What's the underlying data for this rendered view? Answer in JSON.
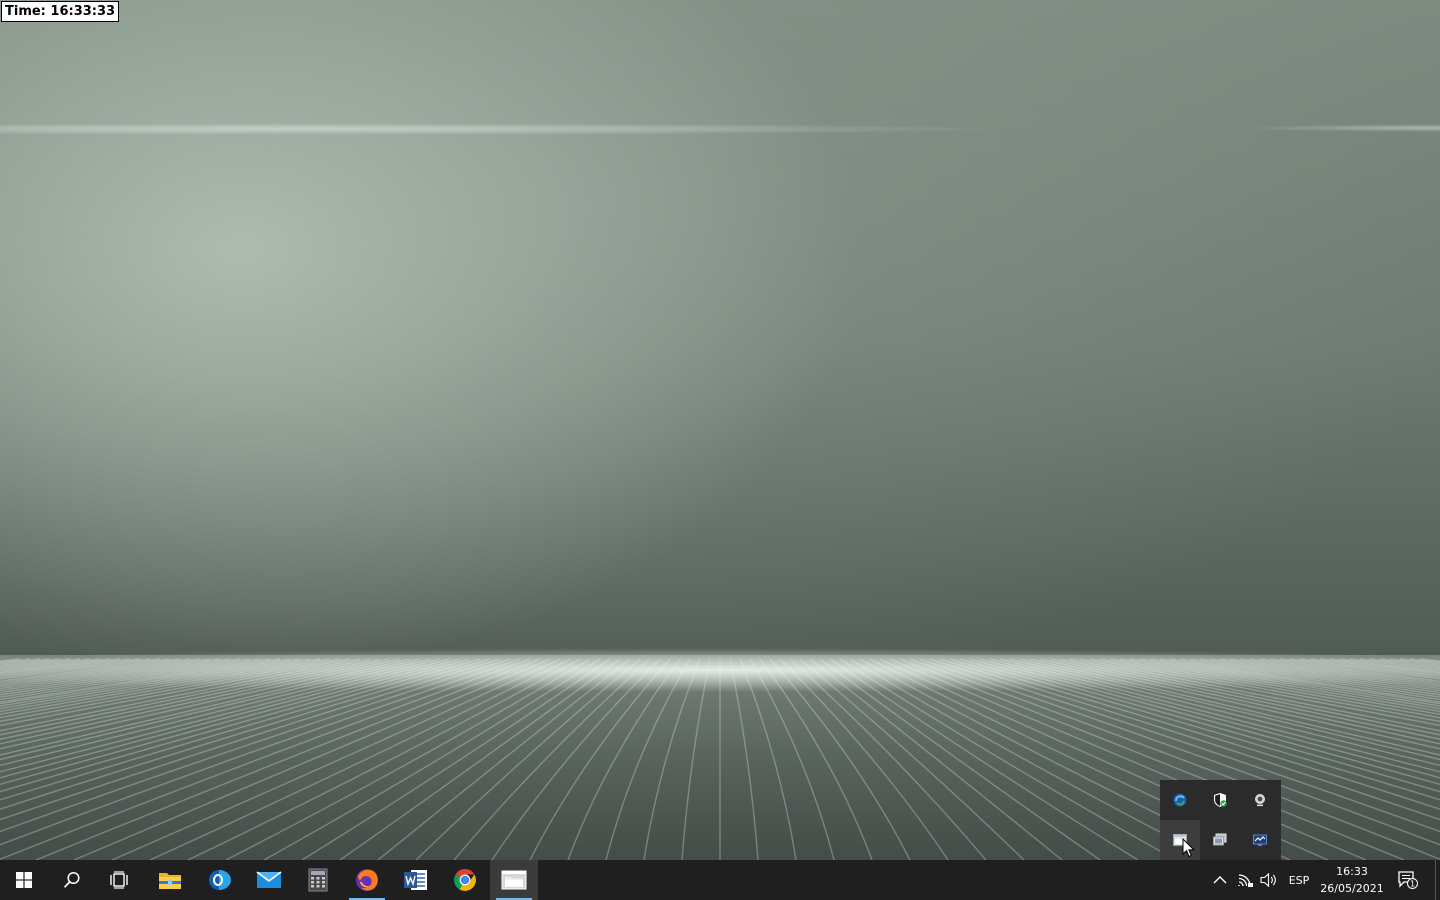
{
  "overlay": {
    "time_label": "Time: 16:33:33"
  },
  "taskbar": {
    "pinned": [
      {
        "id": "start",
        "icon": "windows-logo-icon",
        "running": false,
        "active": false
      },
      {
        "id": "search",
        "icon": "search-icon",
        "running": false,
        "active": false
      },
      {
        "id": "task-view",
        "icon": "task-view-icon",
        "running": false,
        "active": false
      },
      {
        "id": "file-explorer",
        "icon": "folder-icon",
        "running": false,
        "active": false
      },
      {
        "id": "outlook",
        "icon": "outlook-icon",
        "running": false,
        "active": false
      },
      {
        "id": "mail",
        "icon": "mail-icon",
        "running": false,
        "active": false
      },
      {
        "id": "calculator",
        "icon": "calculator-icon",
        "running": false,
        "active": false
      },
      {
        "id": "firefox",
        "icon": "firefox-icon",
        "running": true,
        "active": false
      },
      {
        "id": "word",
        "icon": "word-icon",
        "running": false,
        "active": false
      },
      {
        "id": "chrome",
        "icon": "chrome-icon",
        "running": false,
        "active": false
      },
      {
        "id": "files-app",
        "icon": "files-window-icon",
        "running": true,
        "active": true
      }
    ]
  },
  "tray": {
    "language": "ESP",
    "clock": {
      "time": "16:33",
      "date": "26/05/2021"
    },
    "notifications": {
      "count": "1"
    },
    "hidden_icons": [
      {
        "icon": "edge-sync-icon"
      },
      {
        "icon": "security-shield-icon"
      },
      {
        "icon": "webcam-icon"
      },
      {
        "icon": "window-app-icon"
      },
      {
        "icon": "remote-display-icon"
      },
      {
        "icon": "network-monitor-icon"
      }
    ]
  },
  "colors": {
    "taskbar_bg": "#1f1f1f",
    "flyout_bg": "#2b2b2b",
    "running_indicator": "#76b9ed"
  }
}
